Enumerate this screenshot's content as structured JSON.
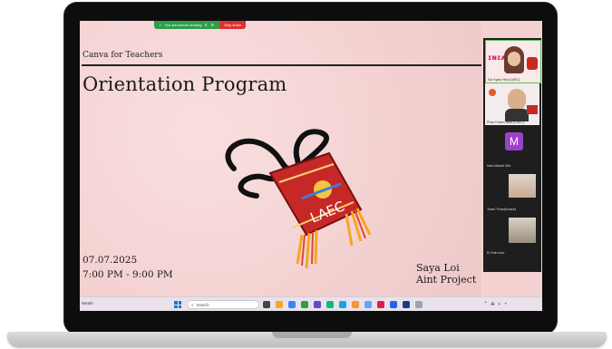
{
  "share_bar": {
    "sharing_text": "You are screen sharing",
    "stop_label": "Stop share"
  },
  "slide": {
    "brand": "Canva for Teachers",
    "title": "Orientation Program",
    "date": "07.07.2025",
    "time": "7:00 PM - 9:00 PM",
    "project": "Saya Loi Aint Project",
    "logo_text": "LAEC"
  },
  "participants": [
    {
      "name": "Sai Kyaw Htut (LAEC)",
      "kind": "video"
    },
    {
      "name": "Phan Khaim Ntua (LAEC)",
      "kind": "video"
    },
    {
      "name": "Naw Mariah Win",
      "kind": "avatar",
      "initial": "M"
    },
    {
      "name": "Thant Thwet(Grace)",
      "kind": "video"
    },
    {
      "name": "Ei Khin mon",
      "kind": "video"
    }
  ],
  "taskbar": {
    "search_placeholder": "Search",
    "weather": "Weath"
  },
  "colors": {
    "slide_bg": "#f4d2d2",
    "share_green": "#2f9e4b",
    "share_red": "#e03131",
    "bag_red": "#c62828"
  }
}
